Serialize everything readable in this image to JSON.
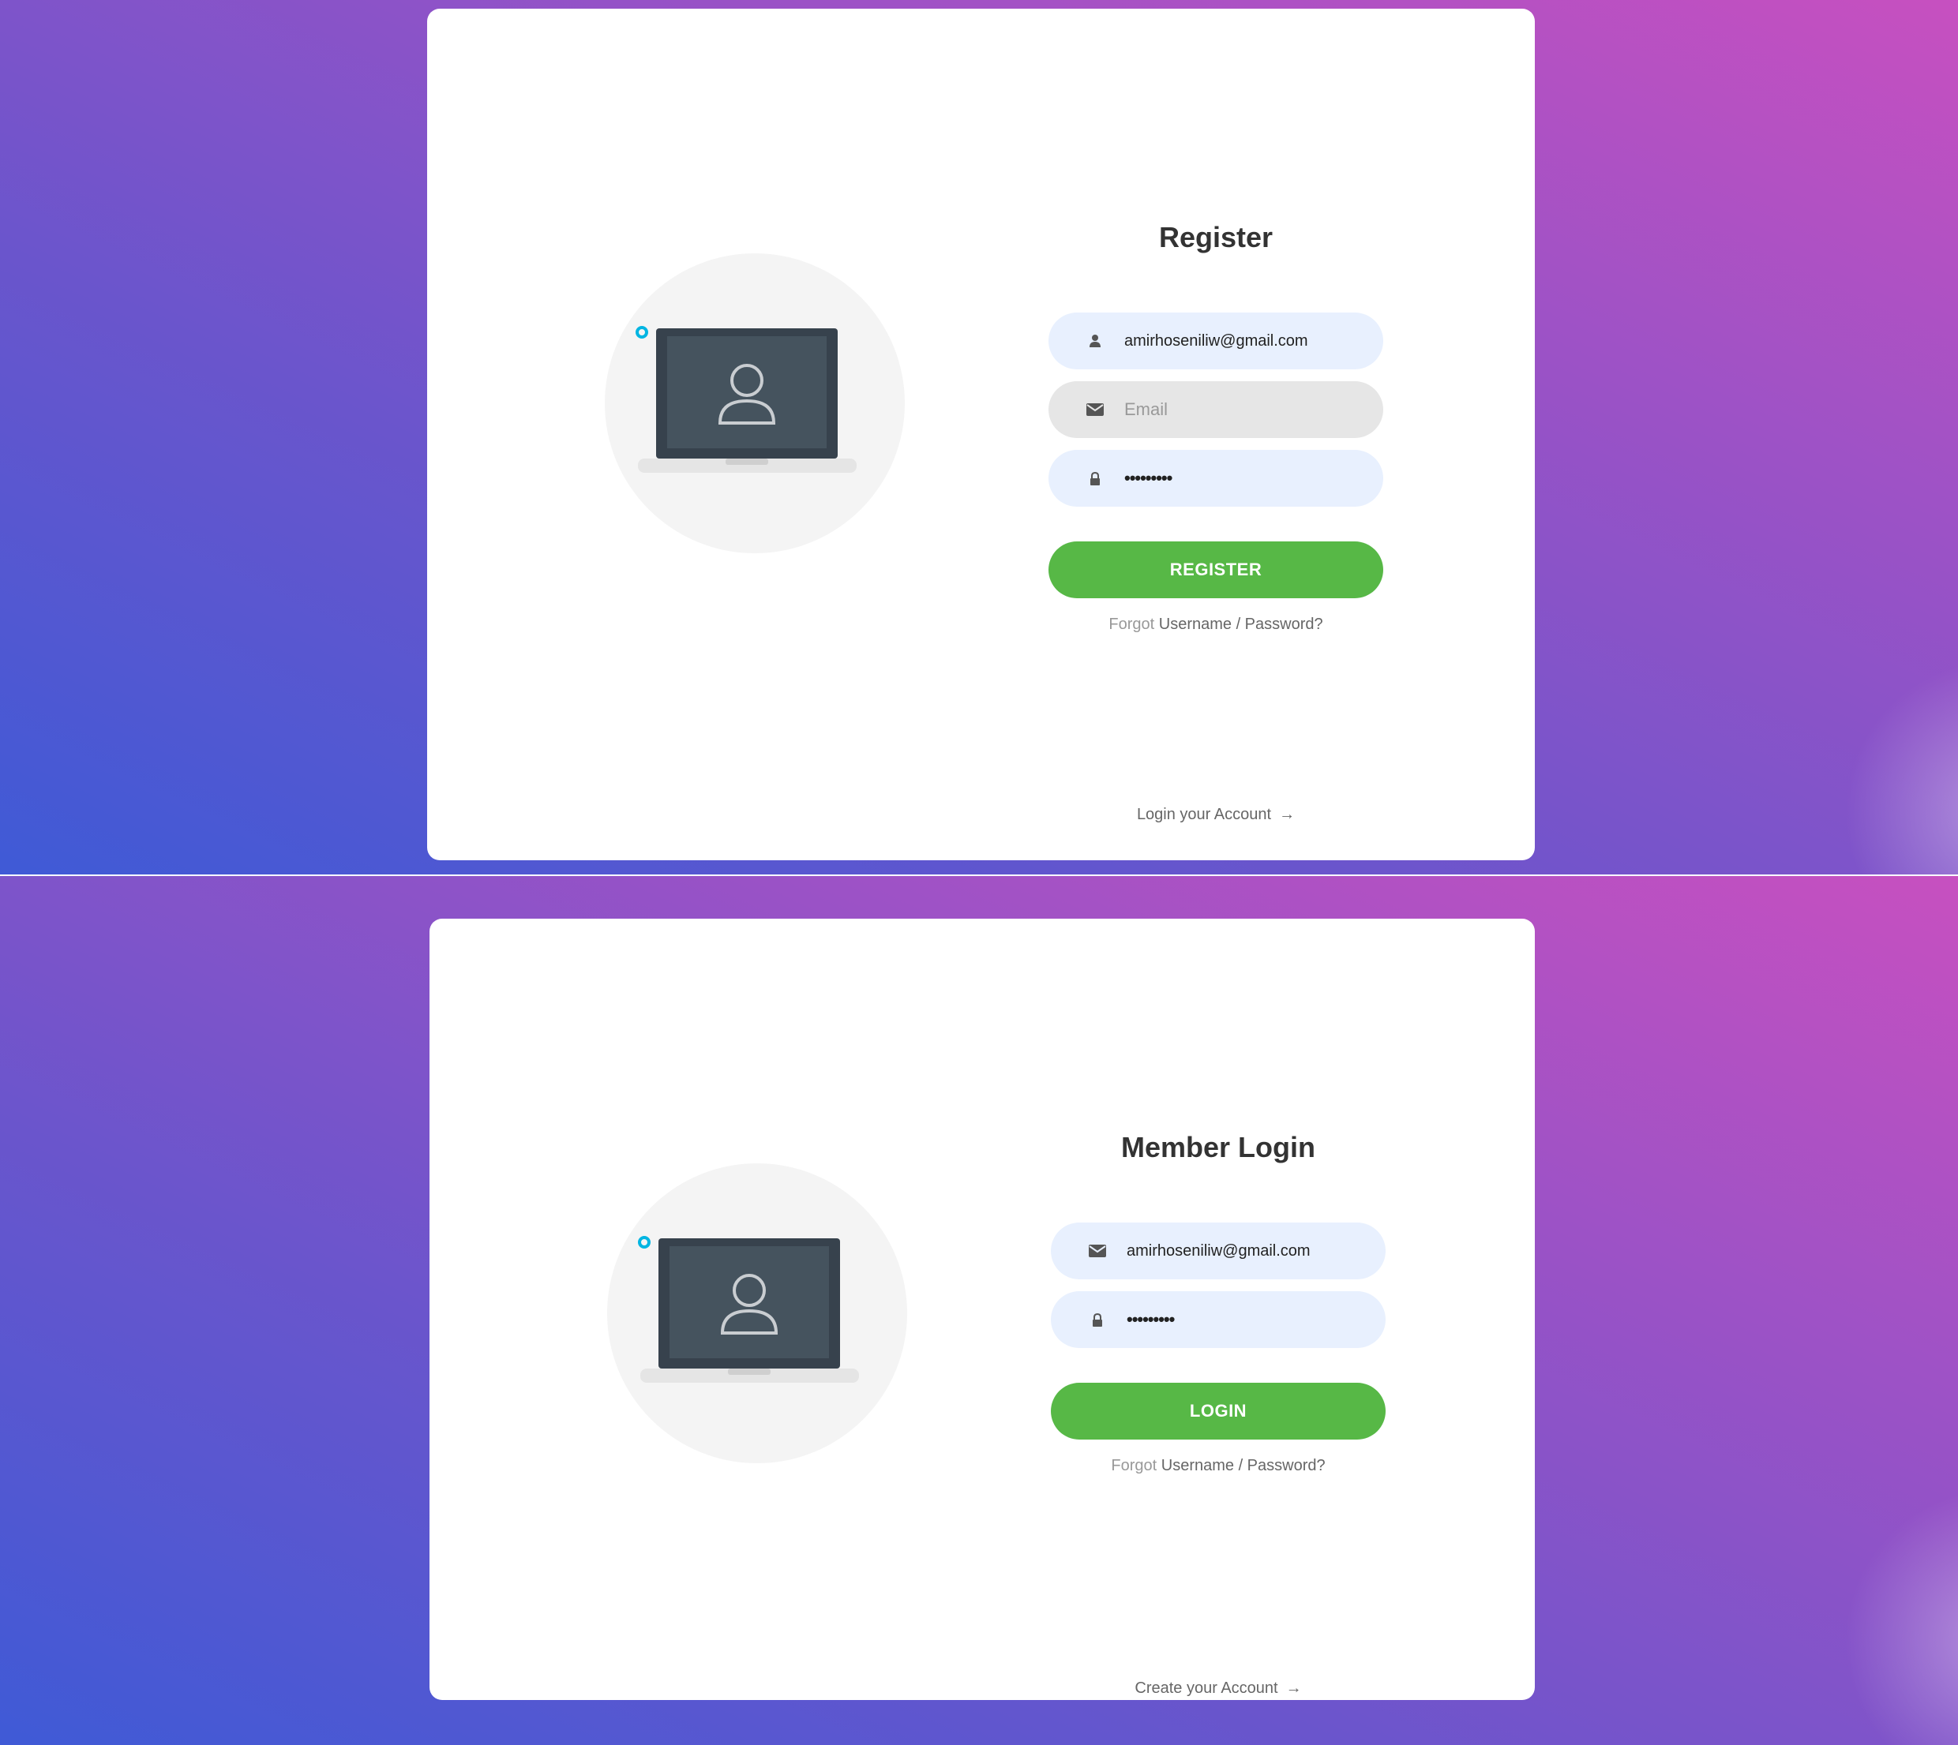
{
  "register": {
    "title": "Register",
    "username_value": "amirhoseniliw@gmail.com",
    "email_placeholder": "Email",
    "password_mask": "•••••••••",
    "button_label": "REGISTER",
    "forgot_prefix": "Forgot",
    "forgot_link": "Username / Password?",
    "account_link": "Login your Account",
    "account_arrow": "→",
    "icons": [
      "user-icon",
      "envelope-icon",
      "lock-icon",
      "arrow-right-icon"
    ]
  },
  "login": {
    "title": "Member Login",
    "email_value": "amirhoseniliw@gmail.com",
    "password_mask": "•••••••••",
    "button_label": "LOGIN",
    "forgot_prefix": "Forgot",
    "forgot_link": "Username / Password?",
    "account_link": "Create your Account",
    "account_arrow": "→",
    "icons": [
      "envelope-icon",
      "lock-icon",
      "arrow-right-icon"
    ]
  },
  "colors": {
    "gradient_start": "#3f5ad6",
    "gradient_end": "#c750c0",
    "button_green": "#57b846",
    "field_fill": "#e8f0fe",
    "field_empty_fill": "#e6e6e6",
    "shape_cyan": "#00b5e2",
    "shape_green": "#57b846"
  }
}
